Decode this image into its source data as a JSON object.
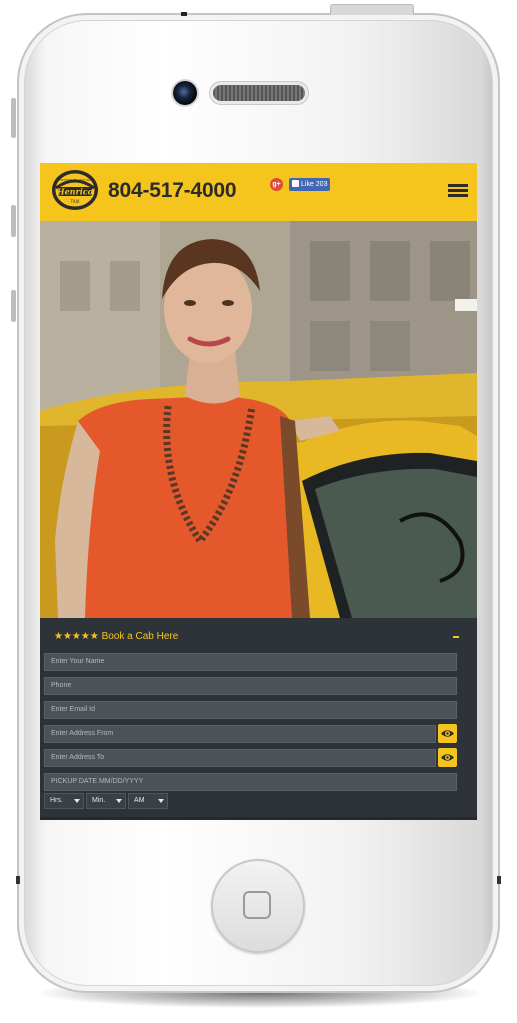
{
  "header": {
    "logo_text": "Henrico",
    "logo_tagline": "THE MOST RELIABLE TAXI",
    "logo_sub": "TAXI",
    "phone_number": "804-517-4000",
    "gplus_label": "g+",
    "fb_like_label": "Like 203",
    "accent_color": "#f5c51e"
  },
  "hero": {
    "image_description_icon": "photo-woman-taxi"
  },
  "booking": {
    "title": "★★★★★ Book a Cab Here",
    "toggle_symbol": "-",
    "fields": {
      "name_placeholder": "Enter Your Name",
      "phone_placeholder": "Phone",
      "email_placeholder": "Enter Email Id",
      "address_from_placeholder": "Enter Address From",
      "address_to_placeholder": "Enter Address To",
      "pickup_date_placeholder": "PICKUP DATE MM/DD/YYYY"
    },
    "selects": {
      "hours": "Hrs.",
      "minutes": "Min.",
      "ampm": "AM"
    },
    "icons": {
      "address_from_button": "eye-icon",
      "address_to_button": "eye-icon"
    }
  }
}
